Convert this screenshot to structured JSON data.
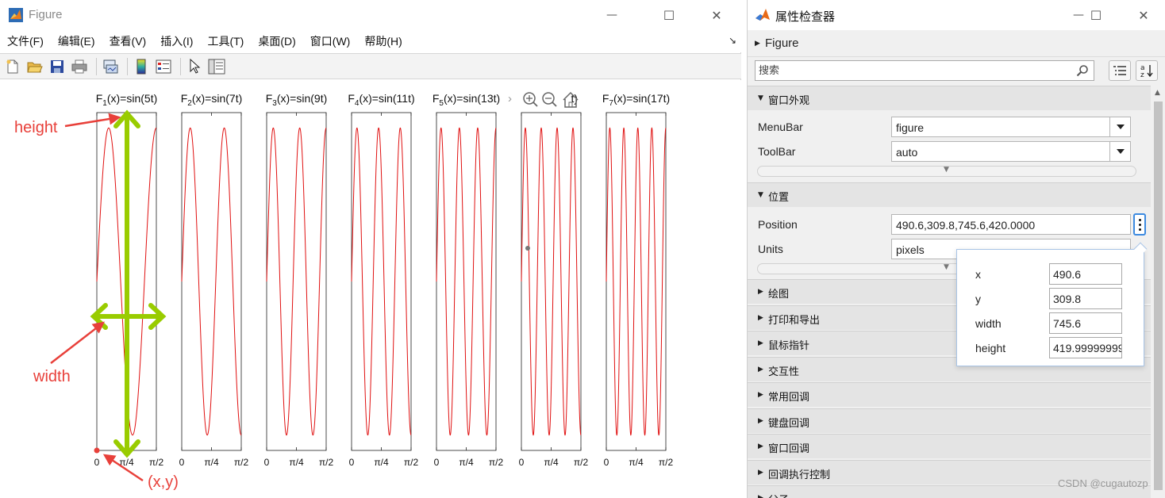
{
  "figure_window": {
    "title": "Figure",
    "menu": [
      "文件(F)",
      "编辑(E)",
      "查看(V)",
      "插入(I)",
      "工具(T)",
      "桌面(D)",
      "窗口(W)",
      "帮助(H)"
    ],
    "minimize_glyph": "—",
    "maximize_glyph": "☐",
    "close_glyph": "✕",
    "dock_glyph": "↘"
  },
  "chart_data": [
    {
      "type": "line",
      "title_base": "F",
      "title_sub": "1",
      "title_rest": "(x)=sin(5t)",
      "frequency": 5,
      "x_ticks": [
        "0",
        "π/4",
        "π/2"
      ],
      "xlim": [
        0,
        1.5708
      ],
      "ylim": [
        -1.1,
        1.1
      ],
      "color": "#e01010"
    },
    {
      "type": "line",
      "title_base": "F",
      "title_sub": "2",
      "title_rest": "(x)=sin(7t)",
      "frequency": 7,
      "x_ticks": [
        "0",
        "π/4",
        "π/2"
      ],
      "xlim": [
        0,
        1.5708
      ],
      "ylim": [
        -1.1,
        1.1
      ],
      "color": "#e01010"
    },
    {
      "type": "line",
      "title_base": "F",
      "title_sub": "3",
      "title_rest": "(x)=sin(9t)",
      "frequency": 9,
      "x_ticks": [
        "0",
        "π/4",
        "π/2"
      ],
      "xlim": [
        0,
        1.5708
      ],
      "ylim": [
        -1.1,
        1.1
      ],
      "color": "#e01010"
    },
    {
      "type": "line",
      "title_base": "F",
      "title_sub": "4",
      "title_rest": "(x)=sin(11t)",
      "frequency": 11,
      "x_ticks": [
        "0",
        "π/4",
        "π/2"
      ],
      "xlim": [
        0,
        1.5708
      ],
      "ylim": [
        -1.1,
        1.1
      ],
      "color": "#e01010"
    },
    {
      "type": "line",
      "title_base": "F",
      "title_sub": "5",
      "title_rest": "(x)=sin(13t)",
      "frequency": 13,
      "x_ticks": [
        "0",
        "π/4",
        "π/2"
      ],
      "xlim": [
        0,
        1.5708
      ],
      "ylim": [
        -1.1,
        1.1
      ],
      "color": "#e01010"
    },
    {
      "type": "line",
      "title_base": "",
      "title_sub": "",
      "title_rest": "t)",
      "frequency": 15,
      "x_ticks": [
        "0",
        "π/4",
        "π/2"
      ],
      "xlim": [
        0,
        1.5708
      ],
      "ylim": [
        -1.1,
        1.1
      ],
      "color": "#e01010"
    },
    {
      "type": "line",
      "title_base": "F",
      "title_sub": "7",
      "title_rest": "(x)=sin(17t)",
      "frequency": 17,
      "x_ticks": [
        "0",
        "π/4",
        "π/2"
      ],
      "xlim": [
        0,
        1.5708
      ],
      "ylim": [
        -1.1,
        1.1
      ],
      "color": "#e01010"
    }
  ],
  "annotations": {
    "height_label": "height",
    "width_label": "width",
    "origin_label": "(x,y)",
    "arrow_color": "#99cc00",
    "text_color": "#e8403a"
  },
  "inspector": {
    "title": "属性检查器",
    "object_label": "Figure",
    "search_placeholder": "搜索",
    "sections": {
      "appearance": "窗口外观",
      "position": "位置",
      "plot": "绘图",
      "print": "打印和导出",
      "pointer": "鼠标指针",
      "interactivity": "交互性",
      "callbacks": "常用回调",
      "keyboard": "键盘回调",
      "window_callbacks": "窗口回调",
      "callback_exec": "回调执行控制",
      "parent": "父子"
    },
    "props": {
      "menubar_name": "MenuBar",
      "menubar_value": "figure",
      "toolbar_name": "ToolBar",
      "toolbar_value": "auto",
      "position_name": "Position",
      "position_value": "490.6,309.8,745.6,420.0000",
      "units_name": "Units",
      "units_value": "pixels"
    },
    "position_popup": {
      "x_label": "x",
      "x_value": "490.6",
      "y_label": "y",
      "y_value": "309.8",
      "w_label": "width",
      "w_value": "745.6",
      "h_label": "height",
      "h_value": "419.99999999"
    }
  },
  "watermark": "CSDN @cugautozp"
}
